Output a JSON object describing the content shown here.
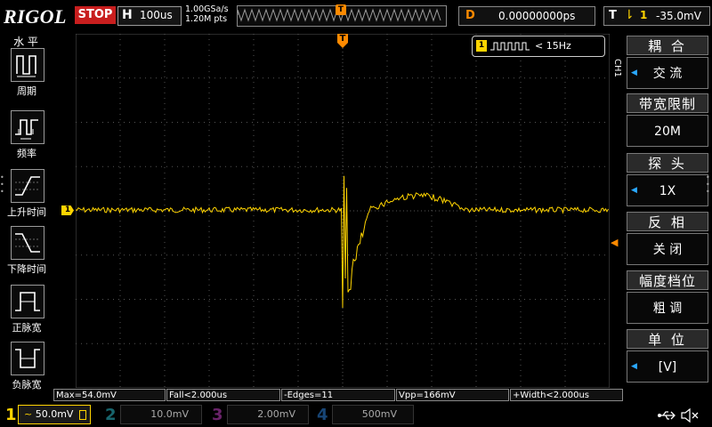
{
  "top_bar": {
    "brand": "RIGOL",
    "run_state": "STOP",
    "horizontal_label": "H",
    "time_base": "100us",
    "sample_rate": "1.00GSa/s",
    "memory_depth": "1.20M pts",
    "trigger_marker": "T",
    "delay_label": "D",
    "delay_value": "0.00000000ps",
    "trigger_label": "T",
    "trigger_edge_symbol": "⇂",
    "trigger_source": "1",
    "trigger_level": "-35.0mV"
  },
  "frequency_counter": {
    "channel": "1",
    "value": "< 15Hz"
  },
  "left_menu": {
    "title": "水 平",
    "items": [
      {
        "label": "周期",
        "icon": "period-icon"
      },
      {
        "label": "频率",
        "icon": "frequency-icon"
      },
      {
        "label": "上升时间",
        "icon": "rise-time-icon"
      },
      {
        "label": "下降时间",
        "icon": "fall-time-icon"
      },
      {
        "label": "正脉宽",
        "icon": "positive-width-icon"
      },
      {
        "label": "负脉宽",
        "icon": "negative-width-icon"
      }
    ]
  },
  "right_menu": {
    "channel_tab": "CH1",
    "items": [
      {
        "label": "耦 合",
        "value": "交 流",
        "has_arrow": true
      },
      {
        "label": "带宽限制",
        "value": "20M",
        "has_arrow": false
      },
      {
        "label": "探 头",
        "value": "1X",
        "has_arrow": true
      },
      {
        "label": "反 相",
        "value": "关 闭",
        "has_arrow": false
      },
      {
        "label": "幅度档位",
        "value": "粗 调",
        "has_arrow": false
      },
      {
        "label": "单 位",
        "value": "[V]",
        "has_arrow": true
      }
    ]
  },
  "ground_marker": "1",
  "trigger_level_marker": "◀",
  "measurements": [
    "Max=54.0mV",
    "Fall<2.000us",
    "-Edges=11",
    "Vpp=166mV",
    "+Width<2.000us"
  ],
  "bottom_bar": {
    "channels": [
      {
        "number": "1",
        "scale": "50.0mV",
        "coupling_symbol": "~",
        "active": true
      },
      {
        "number": "2",
        "scale": "10.0mV",
        "active": false
      },
      {
        "number": "3",
        "scale": "2.00mV",
        "active": false
      },
      {
        "number": "4",
        "scale": "500mV",
        "active": false
      }
    ],
    "usb_icon": "usb-icon",
    "speaker_icon": "speaker-muted-icon"
  },
  "colors": {
    "ch1": "#ffd400",
    "ch2": "#2bb8c6",
    "ch3": "#c040c0",
    "ch4": "#2a7ed6",
    "trigger": "#ff8a00",
    "stop": "#c81e1e",
    "menu_arrow": "#2aa8ff"
  }
}
